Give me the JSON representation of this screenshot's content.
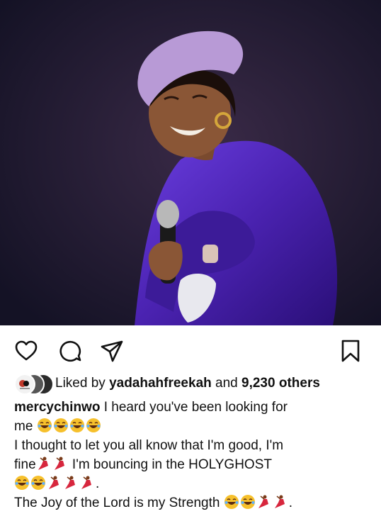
{
  "post": {
    "photo_alt": "mercychinwo post photo"
  },
  "actions": {
    "like_icon": "heart-icon",
    "comment_icon": "comment-icon",
    "share_icon": "send-icon",
    "save_icon": "bookmark-icon"
  },
  "likes": {
    "prefix": "Liked by",
    "user": "yadahahfreekah",
    "joiner": "and",
    "others": "9,230 others"
  },
  "caption": {
    "username": "mercychinwo",
    "line1": "I heard you've been looking for",
    "line2_text": "me",
    "line3": "I thought to let you all know that I'm good, I'm",
    "line4_a": "fine",
    "line4_b": "I'm bouncing in the HOLYGHOST",
    "line5_end": ".",
    "line6": "The Joy of the Lord is my Strength",
    "line6_end": "."
  },
  "colors": {
    "text": "#111111",
    "icon": "#111111",
    "outfit": "#4a2aa6",
    "beret": "#b89ad6"
  }
}
